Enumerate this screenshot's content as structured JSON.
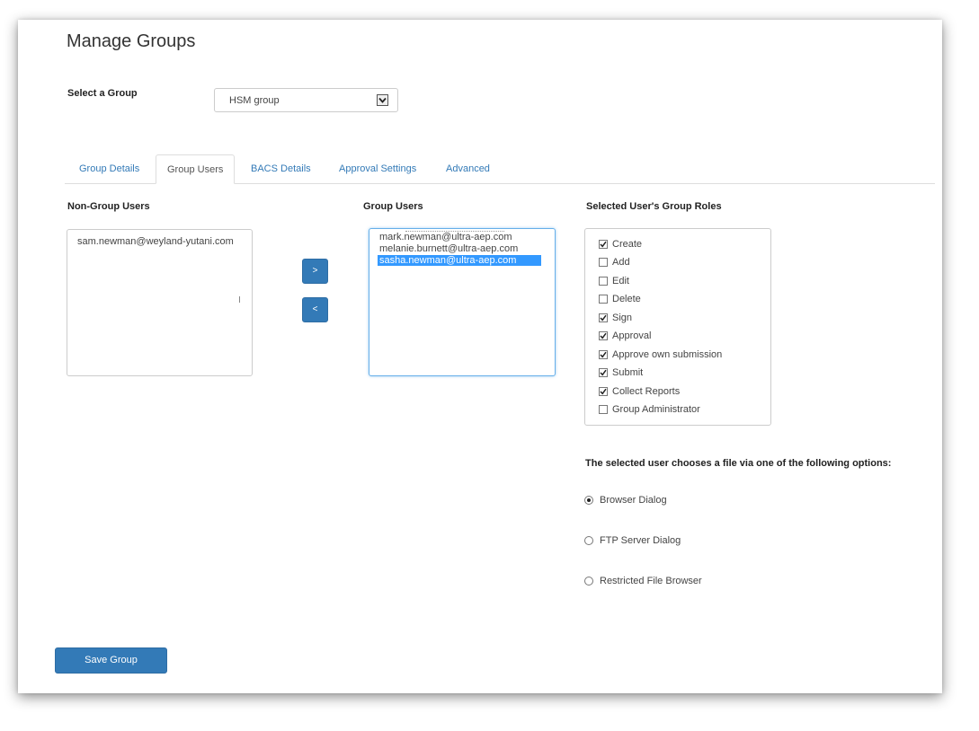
{
  "page": {
    "title": "Manage Groups"
  },
  "group_select": {
    "label": "Select a Group",
    "value": "HSM group"
  },
  "tabs": [
    {
      "label": "Group Details",
      "active": false
    },
    {
      "label": "Group Users",
      "active": true
    },
    {
      "label": "BACS Details",
      "active": false
    },
    {
      "label": "Approval Settings",
      "active": false
    },
    {
      "label": "Advanced",
      "active": false
    }
  ],
  "non_group_users": {
    "heading": "Non-Group Users",
    "items": [
      "sam.newman@weyland-yutani.com"
    ]
  },
  "move_buttons": {
    "add_label": ">",
    "remove_label": "<"
  },
  "group_users": {
    "heading": "Group Users",
    "items": [
      "mark.newman@ultra-aep.com",
      "melanie.burnett@ultra-aep.com",
      "sasha.newman@ultra-aep.com"
    ],
    "selected": "sasha.newman@ultra-aep.com"
  },
  "roles": {
    "heading": "Selected User's Group Roles",
    "items": [
      {
        "label": "Create",
        "checked": true
      },
      {
        "label": "Add",
        "checked": false
      },
      {
        "label": "Edit",
        "checked": false
      },
      {
        "label": "Delete",
        "checked": false
      },
      {
        "label": "Sign",
        "checked": true
      },
      {
        "label": "Approval",
        "checked": true
      },
      {
        "label": "Approve own submission",
        "checked": true
      },
      {
        "label": "Submit",
        "checked": true
      },
      {
        "label": "Collect Reports",
        "checked": true
      },
      {
        "label": "Group Administrator",
        "checked": false
      }
    ]
  },
  "file_options": {
    "heading": "The selected user chooses a file via one of the following options:",
    "options": [
      {
        "label": "Browser Dialog",
        "selected": true
      },
      {
        "label": "FTP Server Dialog",
        "selected": false
      },
      {
        "label": "Restricted File Browser",
        "selected": false
      }
    ]
  },
  "save_button": {
    "label": "Save Group"
  },
  "colors": {
    "primary": "#337ab7",
    "selection": "#3399ff",
    "link": "#337ab7"
  }
}
